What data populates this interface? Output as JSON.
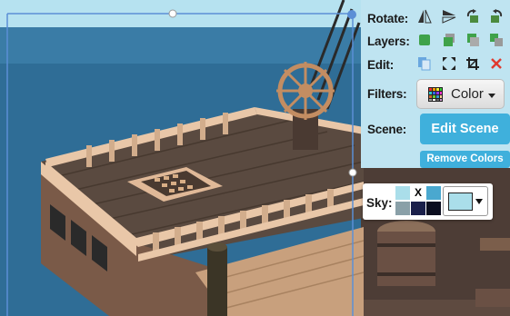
{
  "panel": {
    "rotate_label": "Rotate:",
    "layers_label": "Layers:",
    "edit_label": "Edit:",
    "filters_label": "Filters:",
    "scene_label": "Scene:",
    "sky_label": "Sky:"
  },
  "filters_button": {
    "label": "Color",
    "icon": "color-grid-icon"
  },
  "edit_scene_button": {
    "label": "Edit Scene"
  },
  "remove_colors_button": {
    "label": "Remove Colors"
  },
  "sky": {
    "clear_mark": "X",
    "swatch_colors": [
      "#aadeea",
      "#ffffff",
      "#4aa8cf",
      "#8aa0a8",
      "#1a1f4a",
      "#0b0d1f"
    ],
    "selected_color": "#aadeea"
  },
  "rotate_icons": [
    "flip-horizontal-icon",
    "flip-vertical-icon",
    "rotate-left-icon",
    "rotate-right-icon"
  ],
  "layer_icons": [
    "bring-to-front-icon",
    "bring-forward-icon",
    "send-backward-icon",
    "send-to-back-icon"
  ],
  "edit_icons": [
    "copy-icon",
    "resize-icon",
    "crop-icon",
    "delete-icon"
  ],
  "colors": {
    "accent": "#3fb0dc",
    "sea": "#2f6d96",
    "sky_top": "#b6e2f0",
    "deck": "#5a4a40",
    "rail": "#e9c7a8",
    "hull": "#7a5a48",
    "selection": "#5b8fd6"
  }
}
